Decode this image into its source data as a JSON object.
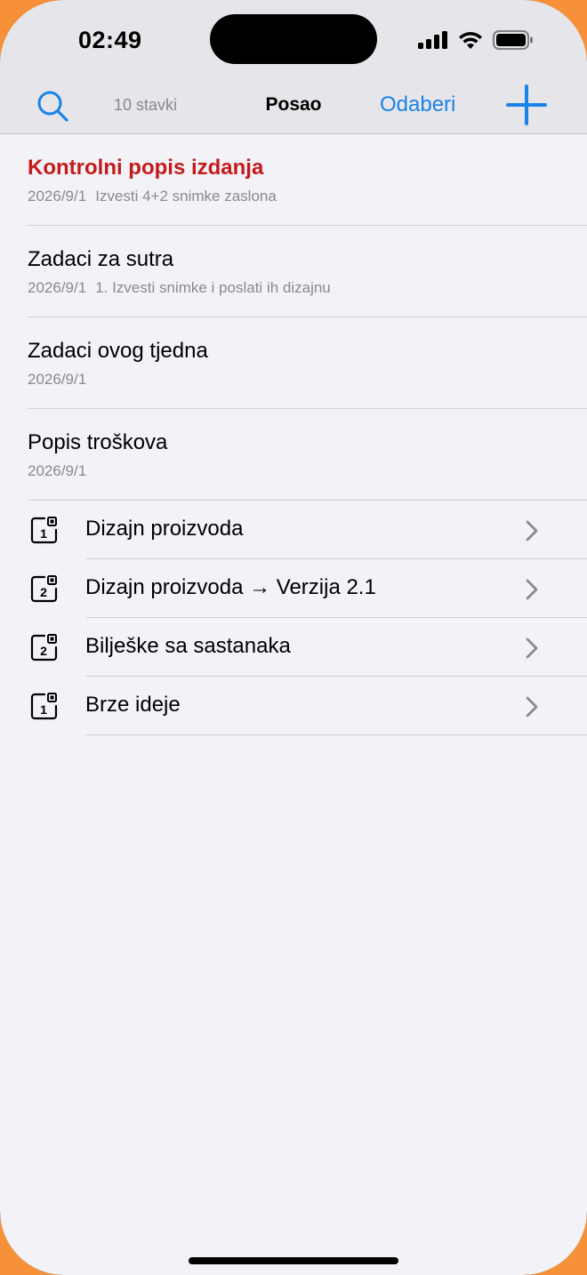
{
  "status_bar": {
    "time": "02:49"
  },
  "nav": {
    "item_count": "10 stavki",
    "title": "Posao",
    "select_label": "Odaberi",
    "accent_color": "#1a82e8"
  },
  "notes": [
    {
      "title": "Kontrolni popis izdanja",
      "date": "2026/9/1",
      "preview": "Izvesti 4+2 snimke zaslona",
      "highlight": true
    },
    {
      "title": "Zadaci za sutra",
      "date": "2026/9/1",
      "preview": "1. Izvesti snimke i poslati ih dizajnu",
      "highlight": false
    },
    {
      "title": "Zadaci ovog tjedna",
      "date": "2026/9/1",
      "preview": "",
      "highlight": false
    },
    {
      "title": "Popis troškova",
      "date": "2026/9/1",
      "preview": "",
      "highlight": false
    }
  ],
  "folders": [
    {
      "label": "Dizajn proizvoda",
      "badge": "1",
      "icon": "folder-badge-icon"
    },
    {
      "label": "Dizajn proizvoda → Verzija 2.1",
      "badge": "2",
      "icon": "folder-badge-icon"
    },
    {
      "label": "Bilješke sa sastanaka",
      "badge": "2",
      "icon": "folder-badge-icon"
    },
    {
      "label": "Brze ideje",
      "badge": "1",
      "icon": "folder-badge-icon"
    }
  ]
}
